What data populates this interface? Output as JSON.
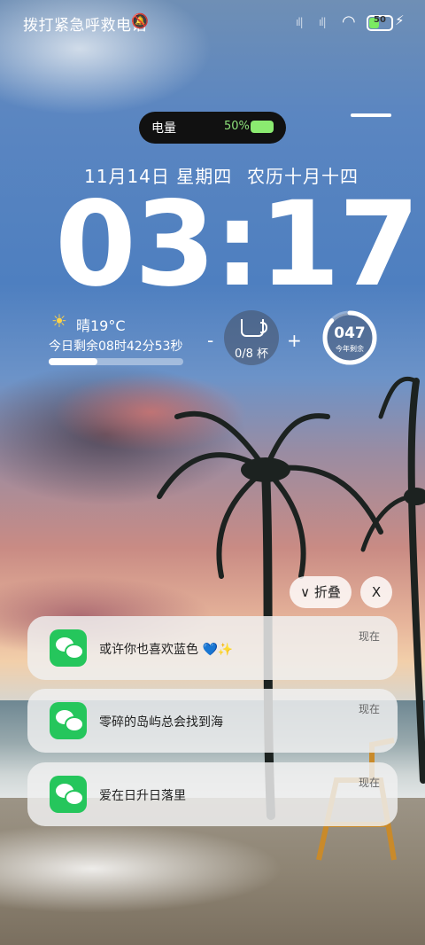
{
  "status_bar": {
    "carrier_text": "拨打紧急呼救电话",
    "mute_icon": "bell-off-icon",
    "signal1": "ıl|",
    "signal2": "ıl|",
    "wifi_icon": "wifi-icon",
    "battery_level": "50",
    "charging_icon": "bolt-icon"
  },
  "battery_pill": {
    "label": "电量",
    "percent": "50%",
    "level": 0.5
  },
  "lock": {
    "date": "11月14日 星期四",
    "lunar_date": "农历十月十四",
    "time": "03:17"
  },
  "weather_widget": {
    "icon": "sun-icon",
    "weather": "晴19°C",
    "remaining": "今日剩余08时42分53秒",
    "day_progress": 0.36
  },
  "water_widget": {
    "minus": "-",
    "plus": "+",
    "count": "0/8 杯",
    "icon": "cup-icon"
  },
  "year_widget": {
    "number": "047",
    "label": "今年剩余",
    "progress": 0.87
  },
  "notification_controls": {
    "collapse_label": "∨ 折叠",
    "close_label": "X"
  },
  "notifications": [
    {
      "app_icon": "wechat-icon",
      "text": "或许你也喜欢蓝色 💙✨",
      "time": "现在"
    },
    {
      "app_icon": "wechat-icon",
      "text": "零碎的岛屿总会找到海",
      "time": "现在"
    },
    {
      "app_icon": "wechat-icon",
      "text": "爱在日升日落里",
      "time": "现在"
    }
  ]
}
